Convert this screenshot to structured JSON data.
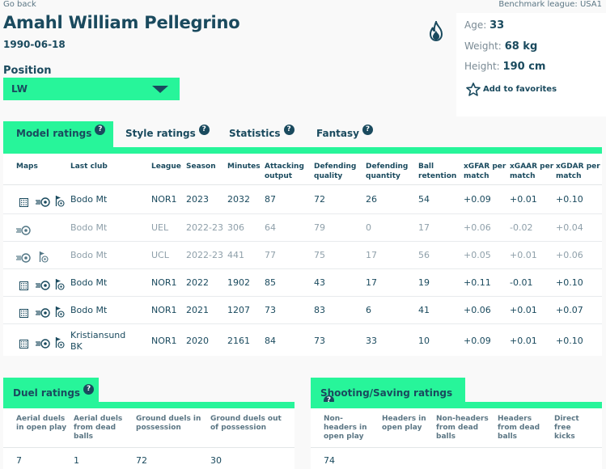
{
  "nav": {
    "go_back": "Go back",
    "benchmark": "Benchmark league: USA1"
  },
  "player": {
    "name": "Amahl William Pellegrino",
    "dob": "1990-06-18",
    "position_label": "Position",
    "position_value": "LW",
    "age_label": "Age:",
    "age": "33",
    "weight_label": "Weight:",
    "weight": "68 kg",
    "height_label": "Height:",
    "height": "190 cm",
    "favorites": "Add to favorites"
  },
  "icons": {
    "hot": "fire-icon",
    "favorite": "star-outline-icon",
    "help": "question-circle-icon",
    "maps": [
      "heatmap-grid-icon",
      "shot-ball-icon",
      "corner-flag-ball-icon"
    ]
  },
  "colors": {
    "accent": "#27f59a",
    "primary": "#1a4a5e",
    "muted": "#8fa0aa"
  },
  "tabs": [
    {
      "label": "Model ratings",
      "active": true
    },
    {
      "label": "Style ratings",
      "active": false
    },
    {
      "label": "Statistics",
      "active": false
    },
    {
      "label": "Fantasy",
      "active": false
    }
  ],
  "table": {
    "columns": [
      "Maps",
      "Last club",
      "League",
      "Season",
      "Minutes",
      "Attacking output",
      "Defending quality",
      "Defending quantity",
      "Ball retention",
      "xGFAR per match",
      "xGAAR per match",
      "xGDAR per match"
    ],
    "rows": [
      {
        "maps": [
          true,
          true,
          true
        ],
        "club": "Bodo Mt",
        "league": "NOR1",
        "season": "2023",
        "minutes": "2032",
        "att": "87",
        "defq": "72",
        "defn": "26",
        "ret": "54",
        "xgfar": "+0.09",
        "xgaar": "+0.01",
        "xgdar": "+0.10",
        "dim": false
      },
      {
        "maps": [
          false,
          true,
          false
        ],
        "club": "Bodo Mt",
        "league": "UEL",
        "season": "2022-23",
        "minutes": "306",
        "att": "64",
        "defq": "79",
        "defn": "0",
        "ret": "17",
        "xgfar": "+0.06",
        "xgaar": "-0.02",
        "xgdar": "+0.04",
        "dim": true
      },
      {
        "maps": [
          false,
          true,
          true
        ],
        "club": "Bodo Mt",
        "league": "UCL",
        "season": "2022-23",
        "minutes": "441",
        "att": "77",
        "defq": "75",
        "defn": "17",
        "ret": "56",
        "xgfar": "+0.05",
        "xgaar": "+0.01",
        "xgdar": "+0.06",
        "dim": true
      },
      {
        "maps": [
          true,
          true,
          true
        ],
        "club": "Bodo Mt",
        "league": "NOR1",
        "season": "2022",
        "minutes": "1902",
        "att": "85",
        "defq": "43",
        "defn": "17",
        "ret": "19",
        "xgfar": "+0.11",
        "xgaar": "-0.01",
        "xgdar": "+0.10",
        "dim": false
      },
      {
        "maps": [
          true,
          true,
          true
        ],
        "club": "Bodo Mt",
        "league": "NOR1",
        "season": "2021",
        "minutes": "1207",
        "att": "73",
        "defq": "83",
        "defn": "6",
        "ret": "41",
        "xgfar": "+0.06",
        "xgaar": "+0.01",
        "xgdar": "+0.07",
        "dim": false
      },
      {
        "maps": [
          true,
          true,
          true
        ],
        "club": "Kristiansund BK",
        "league": "NOR1",
        "season": "2020",
        "minutes": "2161",
        "att": "84",
        "defq": "73",
        "defn": "33",
        "ret": "10",
        "xgfar": "+0.09",
        "xgaar": "+0.01",
        "xgdar": "+0.10",
        "dim": false
      }
    ]
  },
  "duel": {
    "title": "Duel ratings",
    "columns": [
      "Aerial duels in open play",
      "Aerial duels from dead balls",
      "Ground duels in possession",
      "Ground duels out of possession"
    ],
    "values": [
      "7",
      "1",
      "72",
      "30"
    ]
  },
  "shooting": {
    "title": "Shooting/Saving ratings",
    "columns": [
      "Non-headers in open play",
      "Headers in open play",
      "Non-headers from dead balls",
      "Headers from dead balls",
      "Direct free kicks"
    ],
    "values": [
      "74",
      "",
      "",
      "",
      ""
    ]
  }
}
